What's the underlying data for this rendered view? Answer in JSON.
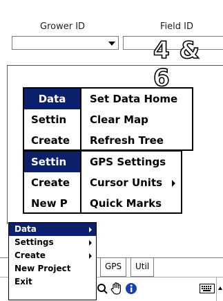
{
  "header": {
    "grower_label": "Grower ID",
    "field_label": "Field ID",
    "grower_value": "",
    "field_value": "",
    "field_title": "4 & 6"
  },
  "menu1": {
    "left_items": [
      "Data",
      "Settin",
      "Create"
    ],
    "selected_index": 0,
    "sub_items": [
      "Set Data Home",
      "Clear Map",
      "Refresh Tree"
    ]
  },
  "menu2": {
    "left_items": [
      "Settin",
      "Create",
      "New P"
    ],
    "selected_index": 0,
    "sub_items": [
      {
        "label": "GPS Settings",
        "has_submenu": false
      },
      {
        "label": "Cursor Units",
        "has_submenu": true
      },
      {
        "label": "Quick Marks",
        "has_submenu": false
      }
    ]
  },
  "start_menu": {
    "items": [
      {
        "label": "Data",
        "has_submenu": true,
        "selected": true
      },
      {
        "label": "Settings",
        "has_submenu": true,
        "selected": false
      },
      {
        "label": "Create",
        "has_submenu": true,
        "selected": false
      },
      {
        "label": "New Project",
        "has_submenu": false,
        "selected": false
      },
      {
        "label": "Exit",
        "has_submenu": false,
        "selected": false
      }
    ]
  },
  "tabs": [
    "GPS",
    "Util"
  ],
  "taskbar": {
    "icons": [
      "zoom-icon",
      "pan-hand-icon",
      "info-icon",
      "keyboard-icon",
      "up-arrow-icon"
    ]
  },
  "colors": {
    "selection": "#0b1f6b",
    "border": "#000000"
  }
}
